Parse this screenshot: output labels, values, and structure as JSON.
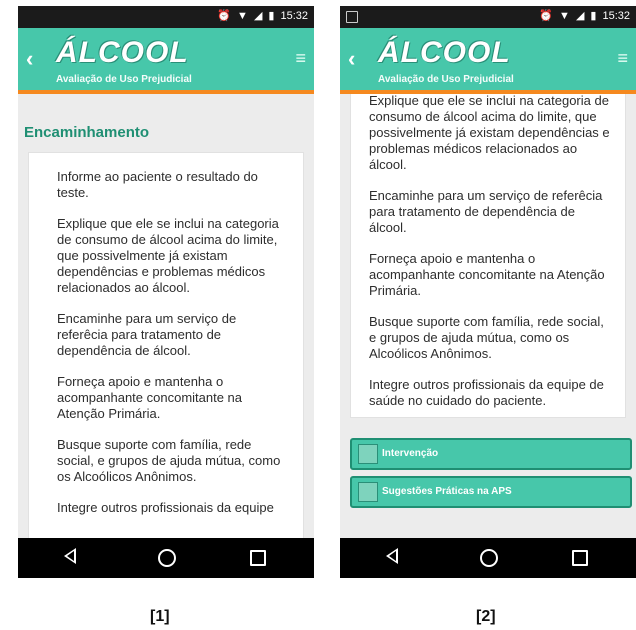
{
  "screens": [
    {
      "status": {
        "time": "15:32"
      },
      "app": {
        "logo_text": "ÁLCOOL",
        "subtitle": "Avaliação de Uso Prejudicial"
      },
      "section_title": "Encaminhamento",
      "paragraphs": [
        "Informe ao paciente o resultado do teste.",
        "Explique que ele se inclui na categoria de consumo de álcool acima do limite, que possivelmente já existam dependências e problemas médicos relacionados ao álcool.",
        "Encaminhe para um serviço de referêcia para tratamento de dependência de álcool.",
        "Forneça apoio e mantenha o acompanhante concomitante na Atenção Primária.",
        "Busque suporte com família, rede social, e grupos de ajuda mútua, como os Alcoólicos Anônimos.",
        "Integre outros profissionais da equipe"
      ]
    },
    {
      "status": {
        "time": "15:32"
      },
      "app": {
        "logo_text": "ÁLCOOL",
        "subtitle": "Avaliação de Uso Prejudicial"
      },
      "paragraphs": [
        "Explique que ele se inclui na categoria de consumo de álcool acima do limite, que possivelmente já existam dependências e problemas médicos relacionados ao álcool.",
        "Encaminhe para um serviço de referêcia para tratamento de dependência de álcool.",
        "Forneça apoio e mantenha o acompanhante concomitante na Atenção Primária.",
        "Busque suporte com família, rede social, e grupos de ajuda mútua, como os Alcoólicos Anônimos.",
        "Integre outros profissionais da equipe de saúde no cuidado do paciente."
      ],
      "accordion": [
        {
          "label": "Intervenção"
        },
        {
          "label": "Sugestões Práticas na APS"
        }
      ]
    }
  ],
  "captions": [
    "[1]",
    "[2]"
  ],
  "colors": {
    "appbar": "#47c7aa",
    "accent_orange": "#f5891f",
    "title_green": "#1f8f73"
  },
  "icons": {
    "back": "chevron-left-icon",
    "menu": "hamburger-menu-icon",
    "nav": [
      "nav-back-icon",
      "nav-home-icon",
      "nav-recents-icon"
    ]
  }
}
